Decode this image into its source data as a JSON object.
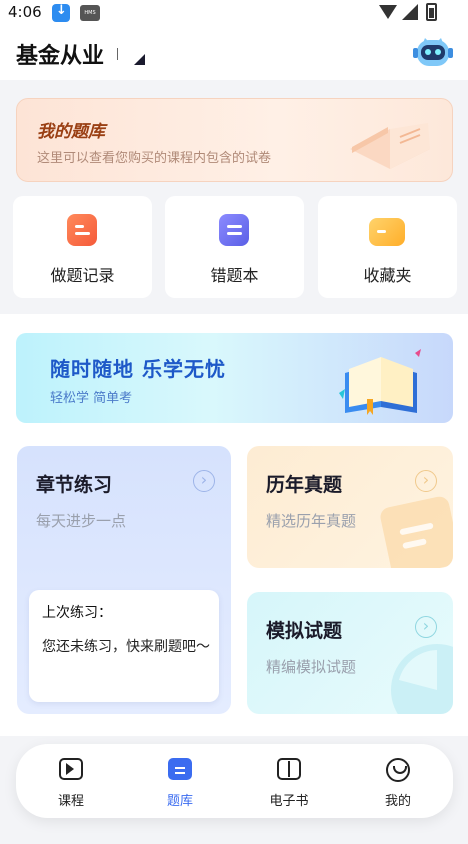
{
  "status_bar": {
    "time": "4:06",
    "icons": [
      "download-icon",
      "hms-icon",
      "wifi-icon",
      "signal-icon",
      "battery-icon"
    ],
    "hms_text": "HMS"
  },
  "header": {
    "title": "基金从业",
    "avatar": "robot-avatar-icon"
  },
  "my_bank": {
    "title": "我的题库",
    "subtitle": "这里可以查看您购买的课程内包含的试卷"
  },
  "quick_actions": [
    {
      "label": "做题记录",
      "icon": "record-icon",
      "color": "#f76b45"
    },
    {
      "label": "错题本",
      "icon": "wrong-book-icon",
      "color": "#6d6cf5"
    },
    {
      "label": "收藏夹",
      "icon": "folder-icon",
      "color": "#ffbb3d"
    }
  ],
  "banner": {
    "title": "随时随地  乐学无忧",
    "subtitle": "轻松学 简单考"
  },
  "cards": {
    "chapter": {
      "title": "章节练习",
      "subtitle": "每天进步一点"
    },
    "past": {
      "title": "历年真题",
      "subtitle": "精选历年真题"
    },
    "mock": {
      "title": "模拟试题",
      "subtitle": "精编模拟试题"
    }
  },
  "last_practice": {
    "title": "上次练习：",
    "body": "您还未练习，快来刷题吧～"
  },
  "tabbar": {
    "active": "题库",
    "accent": "#3b6cf0",
    "tabs": [
      {
        "label": "课程",
        "icon": "video-icon"
      },
      {
        "label": "题库",
        "icon": "question-bank-icon"
      },
      {
        "label": "电子书",
        "icon": "ebook-icon"
      },
      {
        "label": "我的",
        "icon": "profile-icon"
      }
    ]
  }
}
